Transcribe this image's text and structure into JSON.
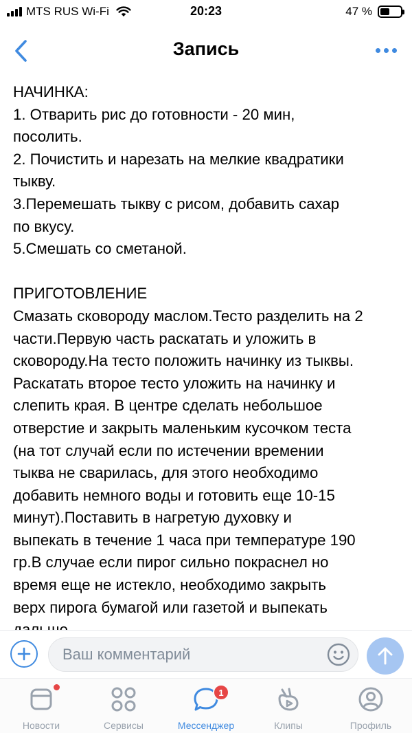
{
  "status_bar": {
    "carrier": "MTS RUS Wi-Fi",
    "time": "20:23",
    "battery_text": "47 %",
    "battery_level": 0.47
  },
  "header": {
    "title": "Запись",
    "back_icon": "chevron-left-icon",
    "more_icon": "more-horizontal-icon"
  },
  "post": {
    "lines": [
      "НАЧИНКА:",
      "1. Отварить рис до готовности - 20 мин,",
      "посолить.",
      "2. Почистить и нарезать на мелкие квадратики",
      "тыкву.",
      "3.Перемешать тыкву с рисом, добавить сахар",
      "по вкусу.",
      "5.Смешать со сметаной.",
      "",
      "ПРИГОТОВЛЕНИЕ",
      "Смазать сковороду маслом.Тесто разделить на 2",
      "части.Первую часть раскатать и уложить в",
      "сковороду.На тесто положить начинку из тыквы.",
      "Раскатать второе тесто уложить на начинку и",
      "слепить края. В центре сделать небольшое",
      "отверстие и закрыть маленьким кусочком теста",
      "(на тот случай если по истечении времении",
      "тыква не сварилась, для этого необходимо",
      "добавить немного воды и готовить еще 10-15",
      "минут).Поставить в нагретую духовку и",
      "выпекать в течение 1 часа при температуре 190",
      "гр.В случае если пирог сильно покраснел но",
      "время еще не истекло, необходимо закрыть",
      "верх пирога бумагой или газетой и выпекать",
      "дальше."
    ]
  },
  "comment_bar": {
    "placeholder": "Ваш комментарий",
    "value": ""
  },
  "tabs": [
    {
      "label": "Новости",
      "icon": "news-icon",
      "badge": "dot",
      "active": false
    },
    {
      "label": "Сервисы",
      "icon": "services-icon",
      "active": false
    },
    {
      "label": "Мессенджер",
      "icon": "messenger-icon",
      "badge_count": "1",
      "active": true
    },
    {
      "label": "Клипы",
      "icon": "clips-icon",
      "active": false
    },
    {
      "label": "Профиль",
      "icon": "profile-icon",
      "active": false
    }
  ],
  "colors": {
    "accent": "#3f8ae0",
    "badge": "#e64646",
    "send_disabled": "#a6c6f2",
    "tab_inactive": "#99a2ad"
  }
}
